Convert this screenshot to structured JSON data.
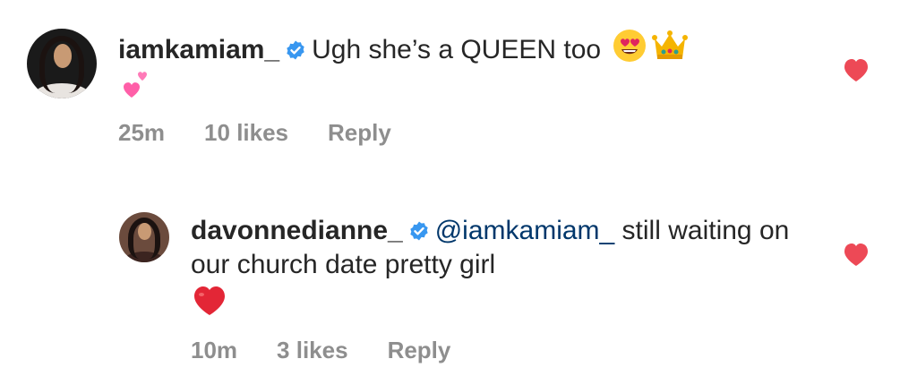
{
  "comments": [
    {
      "username": "iamkamiam_",
      "text": "Ugh she’s a QUEEN too",
      "emojis": [
        "heart-eyes-icon",
        "crown-icon",
        "two-hearts-icon"
      ],
      "time": "25m",
      "likes": "10 likes",
      "reply": "Reply",
      "liked": true
    },
    {
      "username": "davonnedianne_",
      "mention": "@iamkamiam_",
      "text": " still waiting on our church date pretty girl",
      "emojis": [
        "red-heart-icon"
      ],
      "time": "10m",
      "likes": "3 likes",
      "reply": "Reply",
      "liked": true
    }
  ],
  "colors": {
    "like_heart": "#ed4956",
    "verified_badge": "#3897f0",
    "meta_text": "#8e8e8e",
    "mention": "#00376b"
  }
}
